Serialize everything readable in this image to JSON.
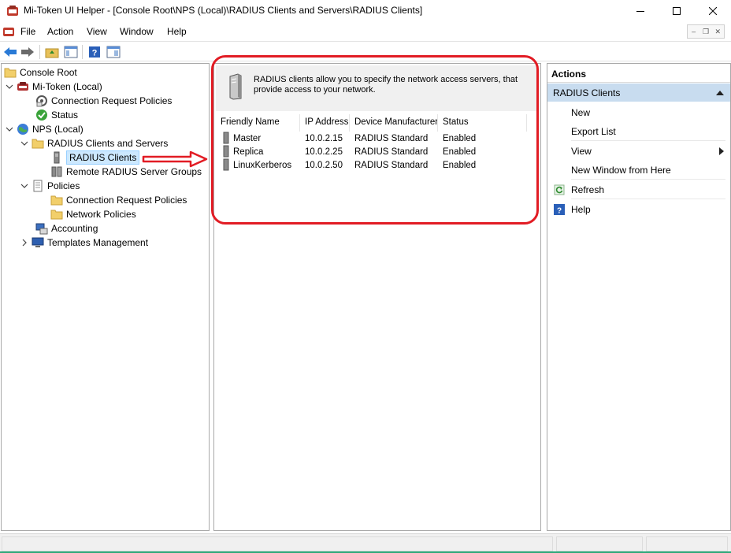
{
  "window": {
    "title": "Mi-Token UI Helper - [Console Root\\NPS (Local)\\RADIUS Clients and Servers\\RADIUS Clients]"
  },
  "menu": {
    "items": [
      "File",
      "Action",
      "View",
      "Window",
      "Help"
    ]
  },
  "toolbar": {
    "buttons": [
      "back-icon",
      "forward-icon",
      "up-folder-icon",
      "show-hide-tree-icon",
      "help-icon",
      "action-pane-icon"
    ]
  },
  "tree": {
    "items": [
      {
        "label": "Console Root",
        "icon": "folder-icon",
        "depth": 0,
        "expander": "none"
      },
      {
        "label": "Mi-Token (Local)",
        "icon": "mi-token-icon",
        "depth": 1,
        "expander": "expanded"
      },
      {
        "label": "Connection Request Policies",
        "icon": "policies-icon",
        "depth": 2,
        "expander": "none"
      },
      {
        "label": "Status",
        "icon": "check-status-icon",
        "depth": 2,
        "expander": "none"
      },
      {
        "label": "NPS (Local)",
        "icon": "nps-globe-icon",
        "depth": 1,
        "expander": "expanded"
      },
      {
        "label": "RADIUS Clients and Servers",
        "icon": "folder-icon",
        "depth": 2,
        "expander": "expanded"
      },
      {
        "label": "RADIUS Clients",
        "icon": "server-icon",
        "depth": 3,
        "expander": "none",
        "selected": true
      },
      {
        "label": "Remote RADIUS Server Groups",
        "icon": "server-group-icon",
        "depth": 3,
        "expander": "none"
      },
      {
        "label": "Policies",
        "icon": "policy-doc-icon",
        "depth": 2,
        "expander": "expanded"
      },
      {
        "label": "Connection Request Policies",
        "icon": "folder-icon",
        "depth": 3,
        "expander": "none"
      },
      {
        "label": "Network Policies",
        "icon": "folder-icon",
        "depth": 3,
        "expander": "none"
      },
      {
        "label": "Accounting",
        "icon": "accounting-icon",
        "depth": 2,
        "expander": "none"
      },
      {
        "label": "Templates Management",
        "icon": "templates-icon",
        "depth": 2,
        "expander": "collapsed"
      }
    ]
  },
  "center": {
    "info_text": "RADIUS clients allow you to specify the network access servers, that provide access to your network.",
    "columns": [
      "Friendly Name",
      "IP Address",
      "Device Manufacturer",
      "Status"
    ],
    "rows": [
      [
        "Master",
        "10.0.2.15",
        "RADIUS Standard",
        "Enabled"
      ],
      [
        "Replica",
        "10.0.2.25",
        "RADIUS Standard",
        "Enabled"
      ],
      [
        "LinuxKerberos",
        "10.0.2.50",
        "RADIUS Standard",
        "Enabled"
      ]
    ]
  },
  "actions": {
    "title": "Actions",
    "group": "RADIUS Clients",
    "items": [
      {
        "label": "New",
        "icon": ""
      },
      {
        "label": "Export List",
        "icon": ""
      },
      {
        "label": "View",
        "icon": "",
        "submenu": true
      },
      {
        "label": "New Window from Here",
        "icon": ""
      },
      {
        "label": "Refresh",
        "icon": "refresh-icon"
      },
      {
        "label": "Help",
        "icon": "help-icon"
      }
    ]
  },
  "colors": {
    "annotation_red": "#e21c24",
    "selection_blue": "#cce8ff",
    "actions_header": "#c8dcef"
  }
}
